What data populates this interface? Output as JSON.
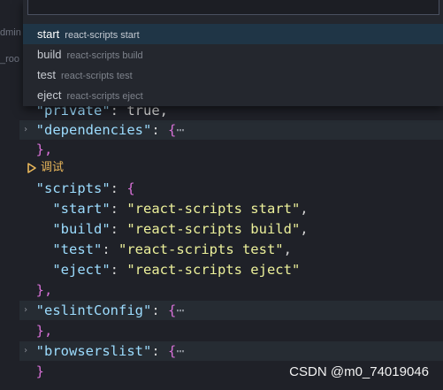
{
  "gutter_fragments": {
    "top": "dmin",
    "second": "_roo"
  },
  "quick_pick": {
    "input_value": "",
    "items": [
      {
        "label": "start",
        "description": "react-scripts start",
        "selected": true
      },
      {
        "label": "build",
        "description": "react-scripts build",
        "selected": false
      },
      {
        "label": "test",
        "description": "react-scripts test",
        "selected": false
      },
      {
        "label": "eject",
        "description": "react-scripts eject",
        "selected": false
      }
    ]
  },
  "code": {
    "private_key": "\"private\"",
    "private_sep": ": ",
    "private_val": "true",
    "comma": ",",
    "colon": ": ",
    "open_brace": "{",
    "close_brace": "}",
    "close_brace_comma": "},",
    "ellipsis": "⋯",
    "dependencies_key": "\"dependencies\"",
    "codelens_label": "调试",
    "scripts_key": "\"scripts\"",
    "scripts": [
      {
        "key": "\"start\"",
        "value": "\"react-scripts start\"",
        "trail": ","
      },
      {
        "key": "\"build\"",
        "value": "\"react-scripts build\"",
        "trail": ","
      },
      {
        "key": "\"test\"",
        "value": "\"react-scripts test\"",
        "trail": ","
      },
      {
        "key": "\"eject\"",
        "value": "\"react-scripts eject\"",
        "trail": ""
      }
    ],
    "eslint_key": "\"eslintConfig\"",
    "browserslist_key": "\"browserslist\""
  },
  "icons": {
    "fold": "chevron-right-icon",
    "debug": "debug-play-icon"
  },
  "colors": {
    "key": "#9cdcfe",
    "string": "#ecf09a",
    "brace": "#d670d6",
    "codelens": "#e9b75a",
    "selection": "#1f3546"
  },
  "watermark": "CSDN @m0_74019046"
}
